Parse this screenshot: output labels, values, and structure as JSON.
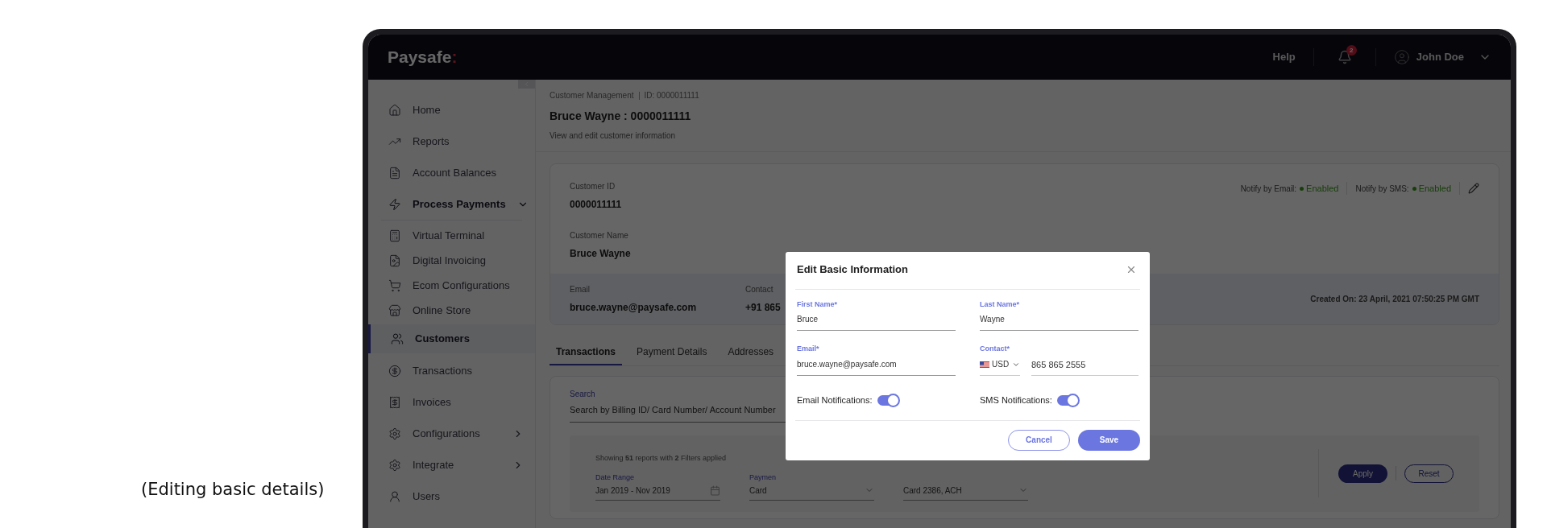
{
  "caption": "(Editing basic details)",
  "header": {
    "logo": "Paysafe",
    "logo_mark": ":",
    "help": "Help",
    "notification_count": "2",
    "user": "John Doe"
  },
  "sidebar": {
    "items": [
      {
        "label": "Home",
        "selected": false
      },
      {
        "label": "Reports",
        "selected": false
      },
      {
        "label": "Account Balances",
        "selected": false
      },
      {
        "label": "Process Payments",
        "selected": false,
        "expanded": true,
        "children": [
          {
            "label": "Virtual Terminal",
            "selected": false
          },
          {
            "label": "Digital Invoicing",
            "selected": false
          },
          {
            "label": "Ecom Configurations",
            "selected": false
          },
          {
            "label": "Online Store",
            "selected": false
          },
          {
            "label": "Customers",
            "selected": true
          }
        ]
      },
      {
        "label": "Transactions",
        "selected": false
      },
      {
        "label": "Invoices",
        "selected": false
      },
      {
        "label": "Configurations",
        "selected": false,
        "expanded": false
      },
      {
        "label": "Integrate",
        "selected": false,
        "expanded": false
      },
      {
        "label": "Users",
        "selected": false
      }
    ]
  },
  "page": {
    "breadcrumb": [
      "Customer Management",
      "ID: 0000011111"
    ],
    "title": "Bruce Wayne : 0000011111",
    "subtitle": "View and edit customer information"
  },
  "customer_card": {
    "fields": [
      {
        "label": "Customer ID",
        "value": "0000011111"
      },
      {
        "label": "Customer Name",
        "value": "Bruce Wayne"
      }
    ],
    "notify": [
      {
        "label": "Notify by Email:",
        "value": "Enabled"
      },
      {
        "label": "Notify by SMS:",
        "value": "Enabled"
      }
    ],
    "footer_fields": [
      {
        "label": "Email",
        "value": "bruce.wayne@paysafe.com"
      },
      {
        "label": "Contact",
        "value": "+91 865"
      }
    ],
    "created_on": "Created On: 23 April, 2021 07:50:25 PM GMT"
  },
  "tabs": [
    {
      "label": "Transactions",
      "selected": true
    },
    {
      "label": "Payment Details",
      "selected": false
    },
    {
      "label": "Addresses",
      "selected": false
    }
  ],
  "search": {
    "label": "Search",
    "placeholder": "Search by Billing ID/ Card Number/ Account Number"
  },
  "filters": {
    "summary": "Showing **51** reports with **2** Filters applied",
    "fields": [
      {
        "label": "Date Range",
        "value": "Jan 2019 - Nov 2019",
        "kind": "date"
      },
      {
        "label": "Paymen",
        "value": "Card",
        "kind": "select"
      },
      {
        "value": "Card 2386, ACH",
        "kind": "select"
      }
    ],
    "apply": "Apply",
    "reset": "Reset"
  },
  "modal": {
    "title": "Edit Basic Information",
    "fields": [
      {
        "label": "First Name*",
        "value": "Bruce",
        "kind": "text"
      },
      {
        "label": "Last Name*",
        "value": "Wayne",
        "kind": "text"
      },
      {
        "label": "Email*",
        "value": "bruce.wayne@paysafe.com",
        "kind": "text"
      },
      {
        "label": "Contact*",
        "currency": "USD",
        "value": "865 865 2555",
        "kind": "phone"
      }
    ],
    "toggles": [
      {
        "label": "Email Notifications:",
        "on": true
      },
      {
        "label": "SMS Notifications:",
        "on": true
      }
    ],
    "cancel": "Cancel",
    "save": "Save"
  }
}
